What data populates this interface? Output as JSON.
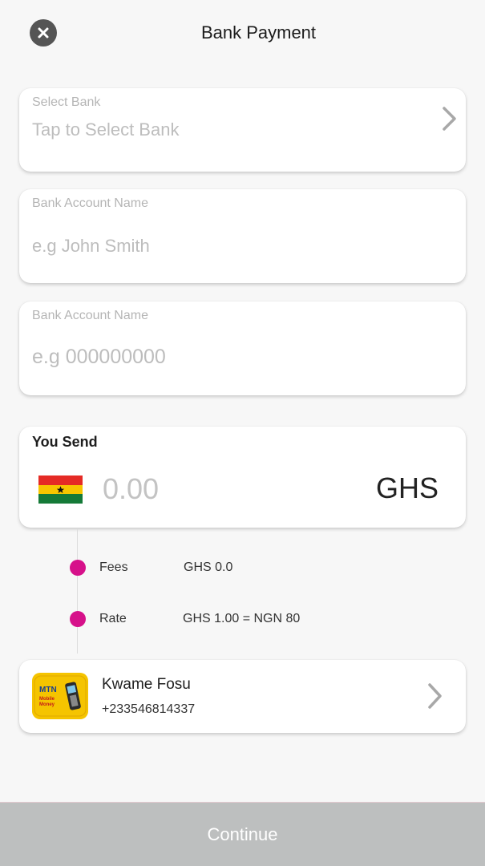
{
  "header": {
    "title": "Bank Payment",
    "close_icon": "close-icon"
  },
  "select_bank": {
    "label": "Select Bank",
    "placeholder": "Tap to Select Bank",
    "chevron_icon": "chevron-right-icon"
  },
  "account_name": {
    "label": "Bank Account Name",
    "placeholder": "e.g John Smith"
  },
  "account_number": {
    "label": "Bank Account Name",
    "placeholder": "e.g 000000000"
  },
  "send": {
    "title": "You Send",
    "amount": "0.00",
    "currency": "GHS",
    "flag_icon": "ghana-flag-icon"
  },
  "fees": {
    "label": "Fees",
    "value": "GHS 0.0"
  },
  "rate": {
    "label": "Rate",
    "value": "GHS 1.00 = NGN 80"
  },
  "recipient": {
    "name": "Kwame Fosu",
    "phone": "+233546814337",
    "logo_text": [
      "MTN",
      "Mobile",
      "Money"
    ],
    "chevron_icon": "chevron-right-icon"
  },
  "continue_label": "Continue",
  "colors": {
    "accent_dot": "#d6118a",
    "button_disabled": "#bdbfbf",
    "mtn_yellow": "#f5c400"
  }
}
